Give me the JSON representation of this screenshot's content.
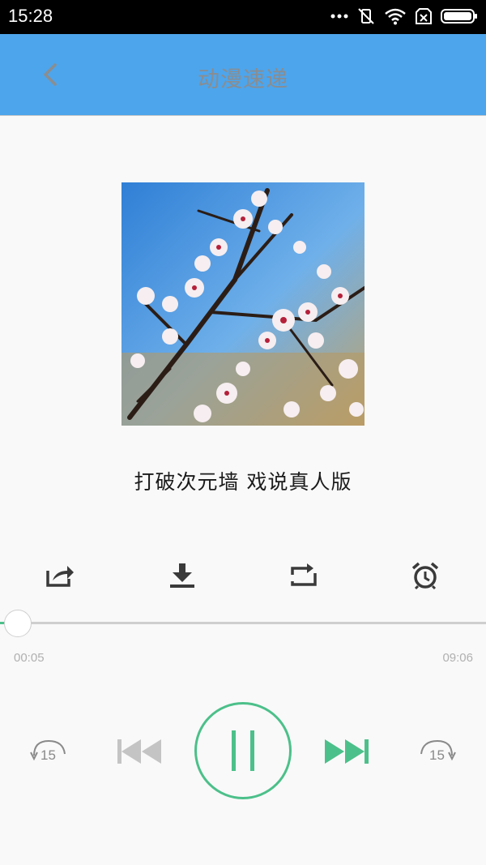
{
  "status_bar": {
    "time": "15:28"
  },
  "header": {
    "title": "动漫速递"
  },
  "track": {
    "title": "打破次元墙  戏说真人版"
  },
  "actions": [
    {
      "name": "share-icon"
    },
    {
      "name": "download-icon"
    },
    {
      "name": "repeat-icon"
    },
    {
      "name": "alarm-icon"
    }
  ],
  "progress": {
    "current": "00:05",
    "total": "09:06",
    "fraction": 0.009
  },
  "controls": {
    "rewind_seconds": "15",
    "forward_seconds": "15"
  },
  "colors": {
    "accent": "#4cc08a",
    "header_bg": "#4da5ec",
    "disabled": "#c4c4c4"
  }
}
